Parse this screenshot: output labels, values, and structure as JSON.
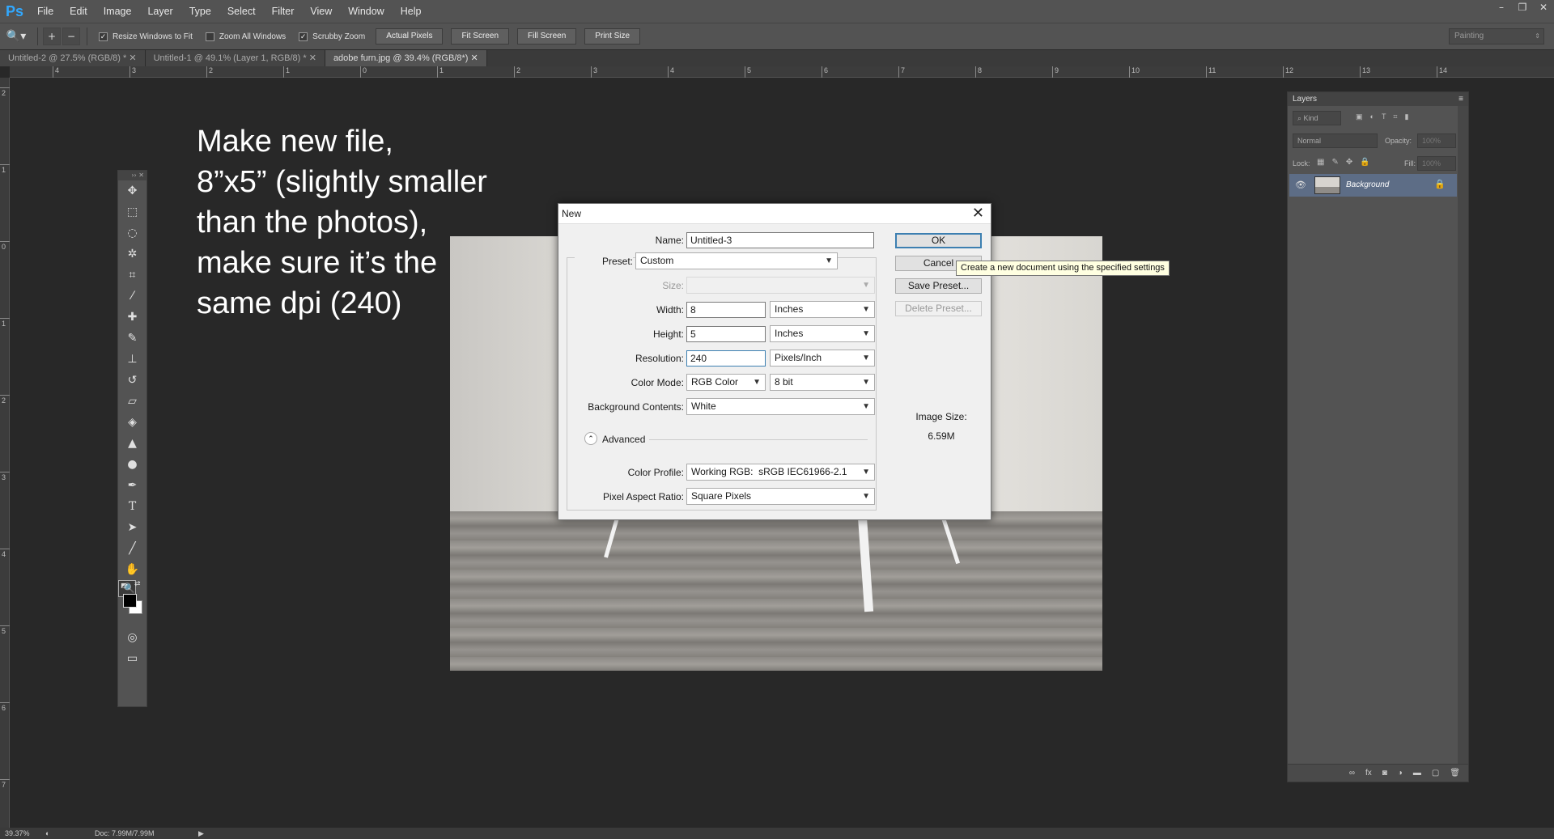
{
  "app": {
    "logo": "Ps",
    "menu": [
      "File",
      "Edit",
      "Image",
      "Layer",
      "Type",
      "Select",
      "Filter",
      "View",
      "Window",
      "Help"
    ],
    "window_controls": [
      "–",
      "❐",
      "✕"
    ]
  },
  "options_bar": {
    "checkboxes": [
      {
        "label": "Resize Windows to Fit",
        "checked": true
      },
      {
        "label": "Zoom All Windows",
        "checked": false
      },
      {
        "label": "Scrubby Zoom",
        "checked": true
      }
    ],
    "buttons": [
      "Actual Pixels",
      "Fit Screen",
      "Fill Screen",
      "Print Size"
    ],
    "workspace": "Painting"
  },
  "tabs": [
    {
      "label": "Untitled-2 @ 27.5% (RGB/8) *",
      "active": false
    },
    {
      "label": "Untitled-1 @ 49.1% (Layer 1, RGB/8) *",
      "active": false
    },
    {
      "label": "adobe furn.jpg @ 39.4% (RGB/8*)",
      "active": true
    }
  ],
  "ruler_top_numbers": [
    "4",
    "3",
    "2",
    "1",
    "0",
    "1",
    "2",
    "3",
    "4",
    "5",
    "6",
    "7",
    "8",
    "9",
    "10",
    "11",
    "12",
    "13",
    "14"
  ],
  "ruler_left_numbers": [
    "2",
    "1",
    "0",
    "1",
    "2",
    "3",
    "4",
    "5",
    "6",
    "7"
  ],
  "instruction": {
    "lines": [
      "Make new file,",
      "8”x5” (slightly smaller",
      "than the photos),",
      "make sure it’s the",
      "same dpi (240)"
    ]
  },
  "dialog": {
    "title": "New",
    "close": "✕",
    "name_label": "Name:",
    "name_value": "Untitled-3",
    "preset_label": "Preset:",
    "preset_value": "Custom",
    "size_label": "Size:",
    "size_value": "",
    "width_label": "Width:",
    "width_value": "8",
    "width_unit": "Inches",
    "height_label": "Height:",
    "height_value": "5",
    "height_unit": "Inches",
    "resolution_label": "Resolution:",
    "resolution_value": "240",
    "resolution_unit": "Pixels/Inch",
    "color_mode_label": "Color Mode:",
    "color_mode_value": "RGB Color",
    "bit_depth_value": "8 bit",
    "bg_contents_label": "Background Contents:",
    "bg_contents_value": "White",
    "advanced_label": "Advanced",
    "color_profile_label": "Color Profile:",
    "color_profile_value": "Working RGB:  sRGB IEC61966-2.1",
    "pixel_aspect_label": "Pixel Aspect Ratio:",
    "pixel_aspect_value": "Square Pixels",
    "ok": "OK",
    "cancel": "Cancel",
    "save_preset": "Save Preset...",
    "delete_preset": "Delete Preset...",
    "image_size_label": "Image Size:",
    "image_size_value": "6.59M"
  },
  "tooltip": "Create a new document using the specified settings",
  "layers_panel": {
    "title": "Layers",
    "kind": "Kind",
    "blend_mode": "Normal",
    "opacity_label": "Opacity:",
    "opacity_value": "100%",
    "lock_label": "Lock:",
    "fill_label": "Fill:",
    "fill_value": "100%",
    "layer_name": "Background"
  },
  "status": {
    "zoom": "39.37%",
    "doc": "Doc: 7.99M/7.99M"
  },
  "colors": {
    "app_bg": "#282828",
    "chrome": "#535353",
    "accent": "#3c7fb1",
    "layer_selected": "#5d6d86"
  }
}
